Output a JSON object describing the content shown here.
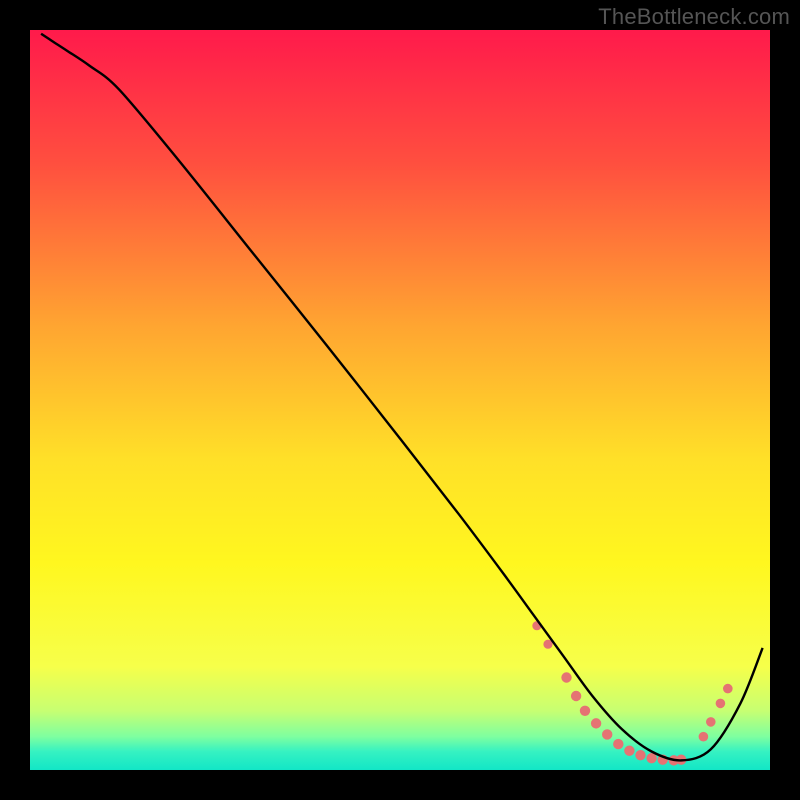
{
  "watermark": "TheBottleneck.com",
  "chart_data": {
    "type": "line",
    "title": "",
    "xlabel": "",
    "ylabel": "",
    "xlim": [
      0,
      100
    ],
    "ylim": [
      0,
      100
    ],
    "grid": false,
    "legend": false,
    "background_gradient_stops": [
      {
        "offset": 0.0,
        "color": "#ff1a4b"
      },
      {
        "offset": 0.18,
        "color": "#ff4f3f"
      },
      {
        "offset": 0.4,
        "color": "#ffa531"
      },
      {
        "offset": 0.58,
        "color": "#ffe028"
      },
      {
        "offset": 0.72,
        "color": "#fff71f"
      },
      {
        "offset": 0.86,
        "color": "#f6ff4a"
      },
      {
        "offset": 0.92,
        "color": "#c7ff72"
      },
      {
        "offset": 0.955,
        "color": "#7effa0"
      },
      {
        "offset": 0.975,
        "color": "#36f2c2"
      },
      {
        "offset": 1.0,
        "color": "#12e6c6"
      }
    ],
    "series": [
      {
        "name": "curve",
        "color": "#000000",
        "x": [
          1.5,
          3.0,
          5.0,
          8.0,
          12.0,
          20.0,
          30.0,
          40.0,
          50.0,
          58.0,
          64.0,
          68.0,
          72.0,
          76.0,
          80.0,
          84.0,
          88.0,
          92.0,
          96.0,
          99.0
        ],
        "y": [
          99.5,
          98.5,
          97.2,
          95.2,
          92.0,
          82.5,
          70.0,
          57.5,
          44.8,
          34.5,
          26.5,
          21.0,
          15.5,
          10.0,
          5.5,
          2.5,
          1.3,
          2.8,
          9.0,
          16.5
        ]
      }
    ],
    "points": [
      {
        "name": "flat-marker",
        "x": 68.5,
        "y": 19.5,
        "r": 4.6,
        "color": "#e57373"
      },
      {
        "name": "flat-marker",
        "x": 70.0,
        "y": 17.0,
        "r": 4.6,
        "color": "#e57373"
      },
      {
        "name": "flat-marker",
        "x": 72.5,
        "y": 12.5,
        "r": 5.2,
        "color": "#e57373"
      },
      {
        "name": "flat-marker",
        "x": 73.8,
        "y": 10.0,
        "r": 5.2,
        "color": "#e57373"
      },
      {
        "name": "flat-marker",
        "x": 75.0,
        "y": 8.0,
        "r": 5.2,
        "color": "#e57373"
      },
      {
        "name": "flat-marker",
        "x": 76.5,
        "y": 6.3,
        "r": 5.2,
        "color": "#e57373"
      },
      {
        "name": "flat-marker",
        "x": 78.0,
        "y": 4.8,
        "r": 5.2,
        "color": "#e57373"
      },
      {
        "name": "flat-marker",
        "x": 79.5,
        "y": 3.5,
        "r": 5.2,
        "color": "#e57373"
      },
      {
        "name": "flat-marker",
        "x": 81.0,
        "y": 2.6,
        "r": 5.2,
        "color": "#e57373"
      },
      {
        "name": "flat-marker",
        "x": 82.5,
        "y": 2.0,
        "r": 5.2,
        "color": "#e57373"
      },
      {
        "name": "flat-marker",
        "x": 84.0,
        "y": 1.6,
        "r": 5.2,
        "color": "#e57373"
      },
      {
        "name": "flat-marker",
        "x": 85.5,
        "y": 1.4,
        "r": 5.2,
        "color": "#e57373"
      },
      {
        "name": "flat-marker",
        "x": 87.0,
        "y": 1.3,
        "r": 5.2,
        "color": "#e57373"
      },
      {
        "name": "flat-marker",
        "x": 88.0,
        "y": 1.4,
        "r": 5.2,
        "color": "#e57373"
      },
      {
        "name": "flat-marker",
        "x": 91.0,
        "y": 4.5,
        "r": 4.8,
        "color": "#e57373"
      },
      {
        "name": "flat-marker",
        "x": 92.0,
        "y": 6.5,
        "r": 4.8,
        "color": "#e57373"
      },
      {
        "name": "flat-marker",
        "x": 93.3,
        "y": 9.0,
        "r": 4.8,
        "color": "#e57373"
      },
      {
        "name": "flat-marker",
        "x": 94.3,
        "y": 11.0,
        "r": 4.8,
        "color": "#e57373"
      }
    ]
  }
}
